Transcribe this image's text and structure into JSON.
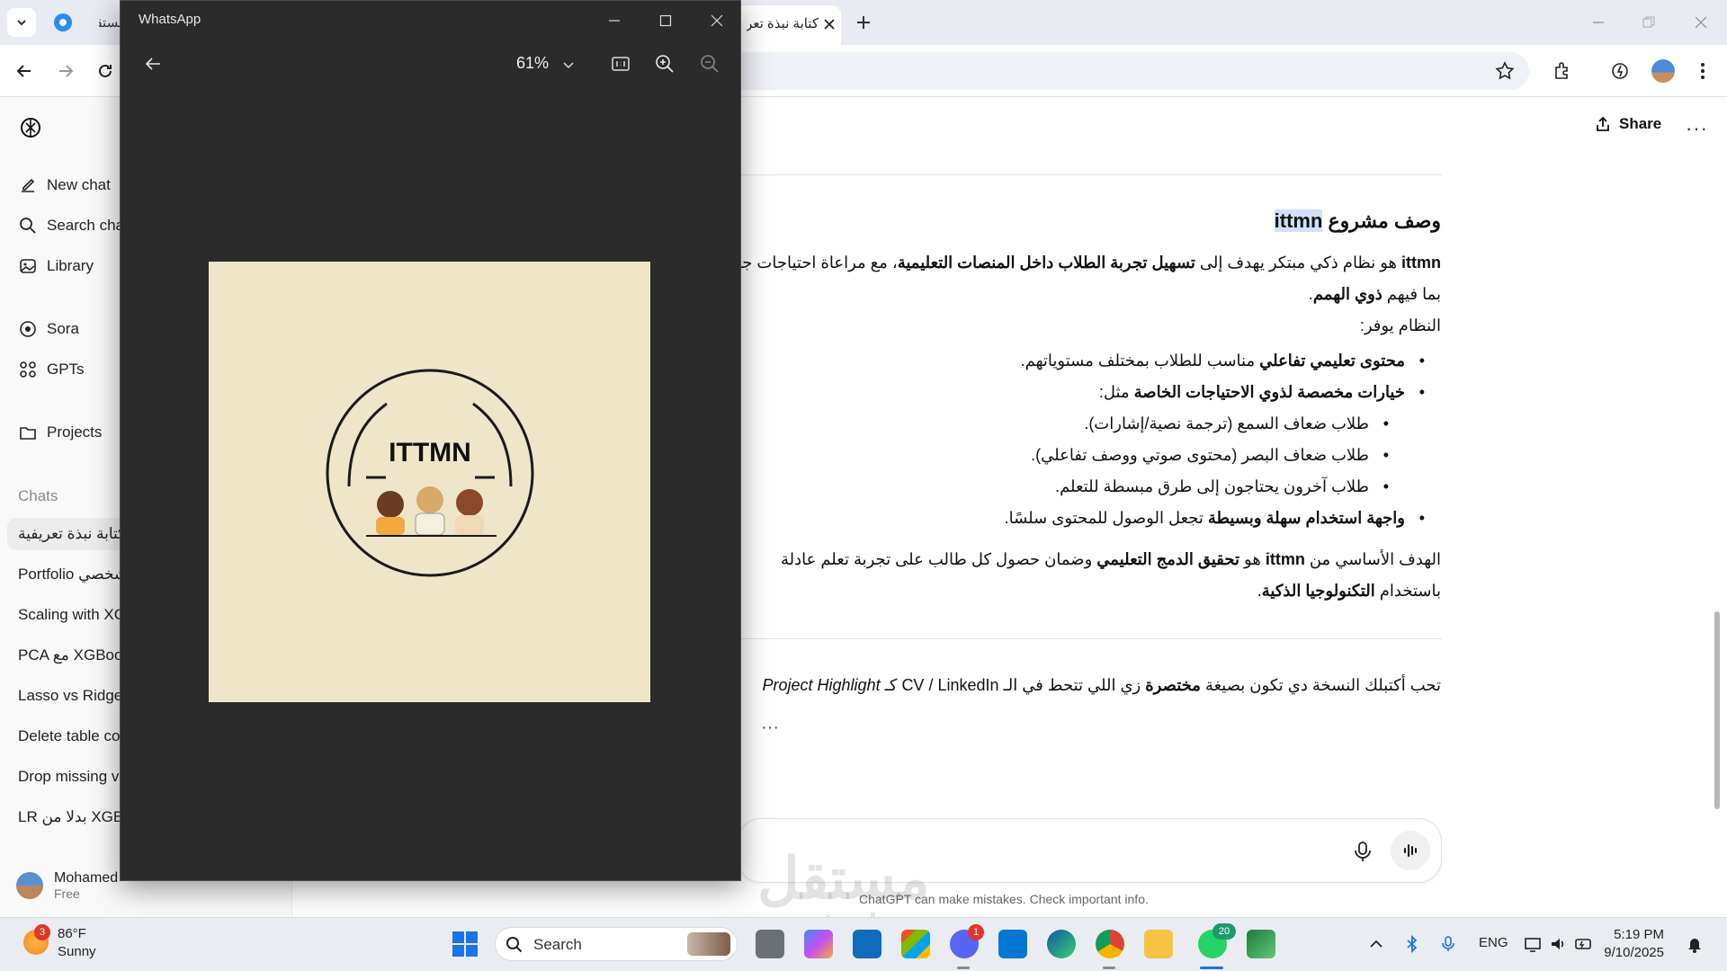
{
  "browser": {
    "tabs": [
      {
        "title": "مستقل"
      },
      {
        "title": "كتابة نبذة تعريفية"
      }
    ],
    "new_tab": "+"
  },
  "sidebar": {
    "items": [
      {
        "label": "New chat",
        "icon": "edit-icon"
      },
      {
        "label": "Search chats",
        "icon": "search-icon"
      },
      {
        "label": "Library",
        "icon": "library-icon"
      },
      {
        "label": "Sora",
        "icon": "sora-icon"
      },
      {
        "label": "GPTs",
        "icon": "grid-icon"
      },
      {
        "label": "Projects",
        "icon": "folder-icon"
      }
    ],
    "chats_title": "Chats",
    "chats": [
      "كتابة نبذة تعريفية",
      "Portfolio شخصي",
      "Scaling with XGBoost",
      "PCA مع XGBoost",
      "Lasso vs Ridge",
      "Delete table column",
      "Drop missing values",
      "LR بدلا من XGBoost"
    ],
    "user": {
      "name": "Mohamed",
      "plan": "Free"
    }
  },
  "header": {
    "share_label": "Share",
    "more": "···"
  },
  "content": {
    "heading_prefix": "وصف مشروع ",
    "heading_highlight": "ittmn",
    "p1_b1": "ittmn",
    "p1_t1": " هو نظام ذكي مبتكر يهدف إلى ",
    "p1_b2": "تسهيل تجربة الطلاب داخل المنصات التعليمية",
    "p1_t2": "، مع مراعاة احتياجات جميع الطلاب",
    "p2_t1": "بما فيهم ",
    "p2_b1": "ذوي الهمم",
    "p2_t2": ".",
    "provides": "النظام يوفر:",
    "b1_bold": "محتوى تعليمي تفاعلي",
    "b1_text": " مناسب للطلاب بمختلف مستوياتهم.",
    "b2_bold": "خيارات مخصصة لذوي الاحتياجات الخاصة",
    "b2_text": " مثل:",
    "sub1": "طلاب ضعاف السمع (ترجمة نصية/إشارات).",
    "sub2": "طلاب ضعاف البصر (محتوى صوتي ووصف تفاعلي).",
    "sub3": "طلاب آخرون يحتاجون إلى طرق مبسطة للتعلم.",
    "b3_bold": "واجهة استخدام سهلة وبسيطة",
    "b3_text": " تجعل الوصول للمحتوى سلسًا.",
    "goal_t1": "الهدف الأساسي من ",
    "goal_b1": "ittmn",
    "goal_t2": " هو ",
    "goal_b2": "تحقيق الدمج التعليمي",
    "goal_t3": " وضمان حصول كل طالب على تجربة تعلم عادلة",
    "goal2_t1": "باستخدام ",
    "goal2_b1": "التكنولوجيا الذكية",
    "goal2_t2": ".",
    "followup_t1": "تحب أكتبلك النسخة دي تكون بصيغة ",
    "followup_b1": "مختصرة",
    "followup_t2": " زي اللي تتحط في الـ CV / LinkedIn كـ ",
    "followup_i1": "Project Highlight",
    "dots": "···"
  },
  "composer": {
    "disclaimer": "ChatGPT can make mistakes. Check important info."
  },
  "watermark": {
    "ar": "مستقل",
    "en": "mostaql.com"
  },
  "whatsapp": {
    "title": "WhatsApp",
    "zoom": "61%",
    "logo_text": "ITTMN"
  },
  "taskbar": {
    "weather_temp": "86°F",
    "weather_cond": "Sunny",
    "weather_badge": "3",
    "search_label": "Search",
    "discord_badge": "1",
    "whatsapp_badge": "20",
    "lang": "ENG",
    "time": "5:19 PM",
    "date": "9/10/2025"
  },
  "colors": {
    "accent_highlight": "#cfe0f8",
    "viewer_bg": "#2b2b2b",
    "logo_bg": "#efe6c9",
    "badge_red": "#e0352b",
    "whatsapp_green": "#25d366"
  }
}
